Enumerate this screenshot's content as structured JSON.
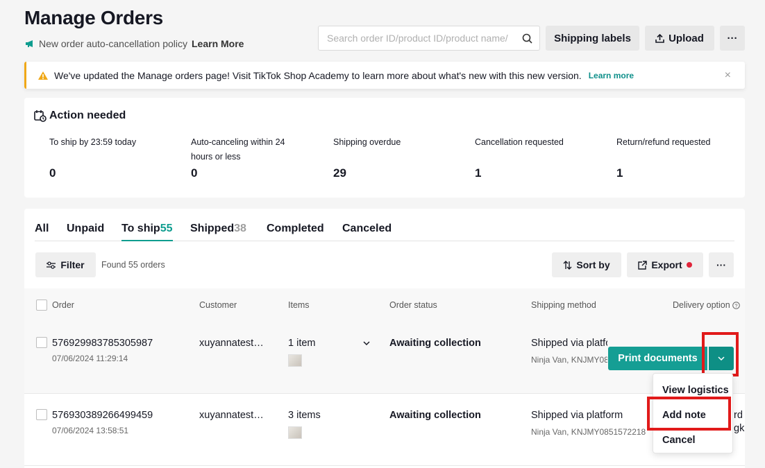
{
  "header": {
    "title": "Manage Orders",
    "policy_text": "New order auto-cancellation policy",
    "policy_link": "Learn More",
    "search_placeholder": "Search order ID/product ID/product name/",
    "shipping_labels": "Shipping labels",
    "upload": "Upload",
    "more": "···"
  },
  "banner": {
    "text": "We've updated the Manage orders page! Visit TikTok Shop Academy to learn more about what's new with this new version.",
    "learn": "Learn more",
    "close": "×"
  },
  "action_needed": {
    "title": "Action needed",
    "metrics": [
      {
        "label": "To ship by 23:59 today",
        "value": "0"
      },
      {
        "label": "Auto-canceling within 24 hours or less",
        "value": "0"
      },
      {
        "label": "Shipping overdue",
        "value": "29"
      },
      {
        "label": "Cancellation requested",
        "value": "1"
      },
      {
        "label": "Return/refund requested",
        "value": "1"
      }
    ]
  },
  "tabs": [
    {
      "label": "All",
      "count": ""
    },
    {
      "label": "Unpaid",
      "count": ""
    },
    {
      "label": "To ship",
      "count": "55"
    },
    {
      "label": "Shipped",
      "count": "38"
    },
    {
      "label": "Completed",
      "count": ""
    },
    {
      "label": "Canceled",
      "count": ""
    }
  ],
  "toolbar": {
    "filter": "Filter",
    "found": "Found 55 orders",
    "sort": "Sort by",
    "export": "Export",
    "more": "···"
  },
  "table": {
    "columns": [
      "Order",
      "Customer",
      "Items",
      "Order status",
      "Shipping method",
      "Delivery option"
    ],
    "rows": [
      {
        "order_id": "576929983785305987",
        "date": "07/06/2024 11:29:14",
        "customer": "xuyannatest…",
        "items": "1 item",
        "status": "Awaiting collection",
        "shipping": "Shipped via platform",
        "carrier": "Ninja Van, KNJMY0851572218",
        "delivery": ""
      },
      {
        "order_id": "576930389266499459",
        "date": "07/06/2024 13:58:51",
        "customer": "xuyannatest…",
        "items": "3 items",
        "status": "Awaiting collection",
        "shipping": "Shipped via platform",
        "carrier": "Ninja Van, KNJMY0851572218",
        "delivery": "rd",
        "delivery_sub": "gk"
      }
    ]
  },
  "actions": {
    "print": "Print documents",
    "menu": [
      "View logistics",
      "Add note",
      "Cancel"
    ]
  },
  "colors": {
    "accent": "#0e9d8f",
    "highlight": "#e11a1a",
    "warning": "#f0a818"
  }
}
